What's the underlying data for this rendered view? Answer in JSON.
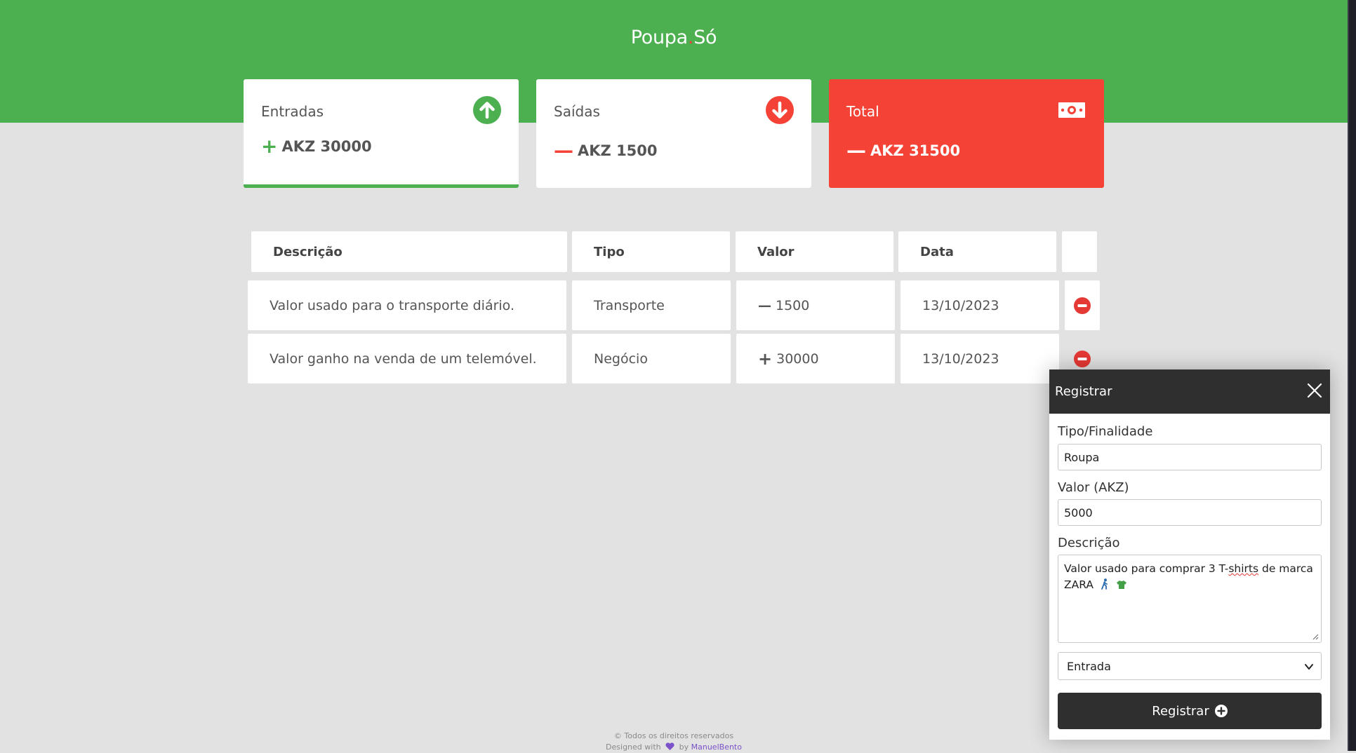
{
  "app": {
    "logo_part1": "Poupa",
    "logo_dot": ".",
    "logo_part2": "Só"
  },
  "cards": {
    "income": {
      "title": "Entradas",
      "sign": "+",
      "value": "AKZ 30000",
      "icon": "arrow-up-circle-icon"
    },
    "expense": {
      "title": "Saídas",
      "sign": "—",
      "value": "AKZ 1500",
      "icon": "arrow-down-circle-icon"
    },
    "total": {
      "title": "Total",
      "sign": "—",
      "value": "AKZ 31500",
      "icon": "money-bill-icon"
    }
  },
  "table": {
    "headers": [
      "Descrição",
      "Tipo",
      "Valor",
      "Data"
    ],
    "rows": [
      {
        "description": "Valor usado para o transporte diário.",
        "type": "Transporte",
        "sign": "—",
        "amount": "1500",
        "date": "13/10/2023",
        "kind": "expense"
      },
      {
        "description": "Valor ganho na venda de um telemóvel.",
        "type": "Negócio",
        "sign": "+",
        "amount": "30000",
        "date": "13/10/2023",
        "kind": "income"
      }
    ]
  },
  "modal": {
    "title": "Registrar",
    "type_label": "Tipo/Finalidade",
    "type_value": "Roupa",
    "amount_label": "Valor (AKZ)",
    "amount_value": "5000",
    "description_label": "Descrição",
    "description_text_1": "Valor usado para comprar 3 T-",
    "description_misspelled": "shirts",
    "description_text_2": " de marca",
    "description_line2": "ZARA",
    "select_value": "Entrada",
    "submit_label": "Registrar"
  },
  "footer": {
    "line1": "© Todos os direitos reservados",
    "designed_with": "Designed with",
    "by": "by",
    "author": "ManuelBento"
  },
  "colors": {
    "primary_green": "#4caf50",
    "danger_red": "#f44336",
    "dark": "#2f2f2f",
    "background": "#e2e2e2"
  }
}
